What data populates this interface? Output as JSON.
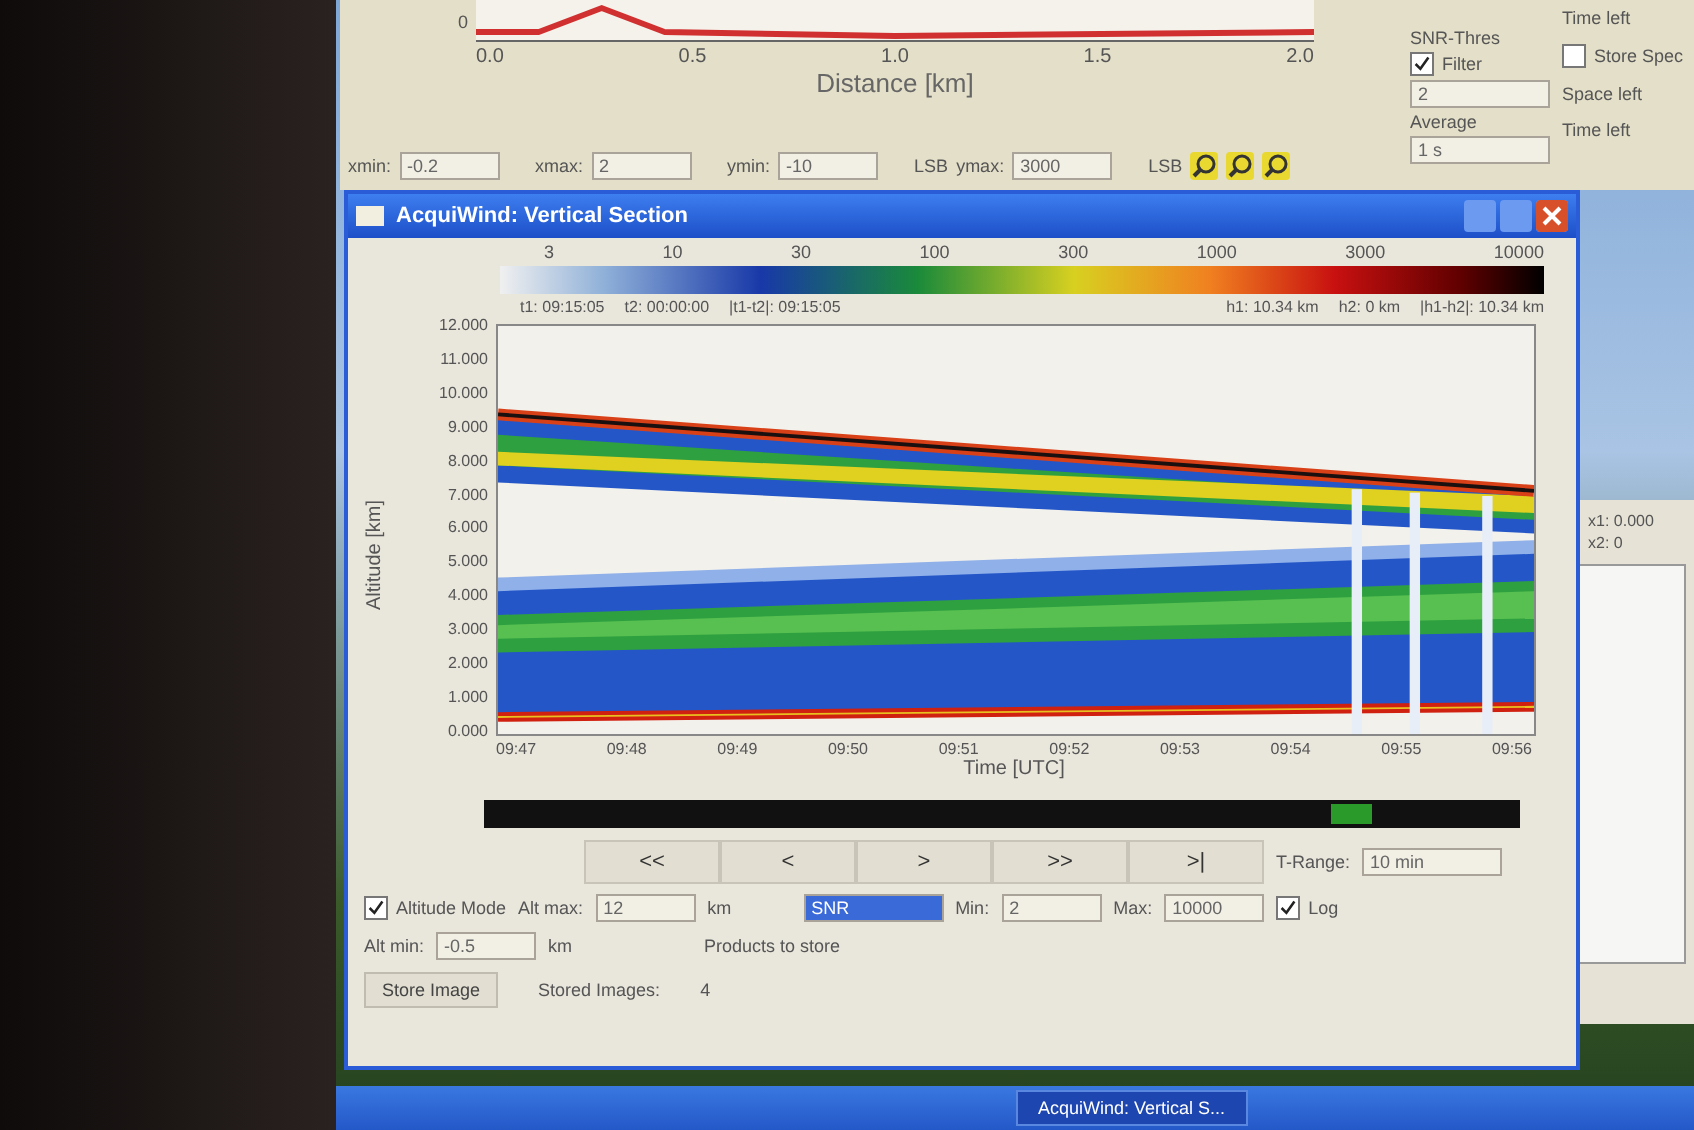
{
  "background_window": {
    "chart": {
      "y_ticks": [
        "0"
      ],
      "x_ticks": [
        "0.0",
        "0.5",
        "1.0",
        "1.5",
        "2.0"
      ],
      "xlabel": "Distance [km]"
    },
    "range_fields": [
      {
        "label": "xmin:",
        "value": "-0.2"
      },
      {
        "label": "xmax:",
        "value": "2"
      },
      {
        "label": "ymin:",
        "value": "-10",
        "unit": "LSB"
      },
      {
        "label": "ymax:",
        "value": "3000",
        "unit": "LSB"
      }
    ],
    "snr_thres": {
      "title": "SNR-Thres",
      "filter_label": "Filter",
      "filter_checked": true,
      "value": "2"
    },
    "average": {
      "title": "Average",
      "value": "1 s"
    },
    "store_spectra": {
      "label": "Store Spec",
      "checked": false
    },
    "status_labels": [
      "Time left",
      "Space left",
      "Time left"
    ]
  },
  "main_window": {
    "title": "AcquiWind: Vertical Section",
    "colorbar_ticks": [
      "3",
      "10",
      "30",
      "100",
      "300",
      "1000",
      "3000",
      "10000"
    ],
    "cursor_info_left": [
      {
        "label": "t1:",
        "value": "09:15:05"
      },
      {
        "label": "t2:",
        "value": "00:00:00"
      },
      {
        "label": "|t1-t2|:",
        "value": "09:15:05"
      }
    ],
    "cursor_info_right": [
      {
        "label": "h1:",
        "value": "10.34 km"
      },
      {
        "label": "h2:",
        "value": "0 km"
      },
      {
        "label": "|h1-h2|:",
        "value": "10.34 km"
      }
    ],
    "plot": {
      "ylabel": "Altitude [km]",
      "y_ticks": [
        "12.000",
        "11.000",
        "10.000",
        "9.000",
        "8.000",
        "7.000",
        "6.000",
        "5.000",
        "4.000",
        "3.000",
        "2.000",
        "1.000",
        "0.000"
      ],
      "x_ticks": [
        "09:47",
        "09:48",
        "09:49",
        "09:50",
        "09:51",
        "09:52",
        "09:53",
        "09:54",
        "09:55",
        "09:56"
      ],
      "xlabel": "Time [UTC]"
    },
    "nav_buttons": [
      "<<",
      "<",
      ">",
      ">>",
      ">|"
    ],
    "t_range": {
      "label": "T-Range:",
      "value": "10 min"
    },
    "altitude_mode": {
      "label": "Altitude Mode",
      "checked": true
    },
    "alt_min": {
      "label": "Alt min:",
      "value": "-0.5",
      "unit": "km"
    },
    "alt_max": {
      "label": "Alt max:",
      "value": "12",
      "unit": "km"
    },
    "product": {
      "value": "SNR"
    },
    "min": {
      "label": "Min:",
      "value": "2"
    },
    "max": {
      "label": "Max:",
      "value": "10000"
    },
    "log": {
      "label": "Log",
      "checked": true
    },
    "store_button": "Store Image",
    "stored_images": {
      "label": "Stored Images:",
      "value": "4"
    },
    "products_menu": "Products to store"
  },
  "side_window": {
    "cursor": [
      "x1: 0.000",
      "x2: 0"
    ]
  },
  "taskbar": [
    "AcquiWind: Vertical S..."
  ]
}
